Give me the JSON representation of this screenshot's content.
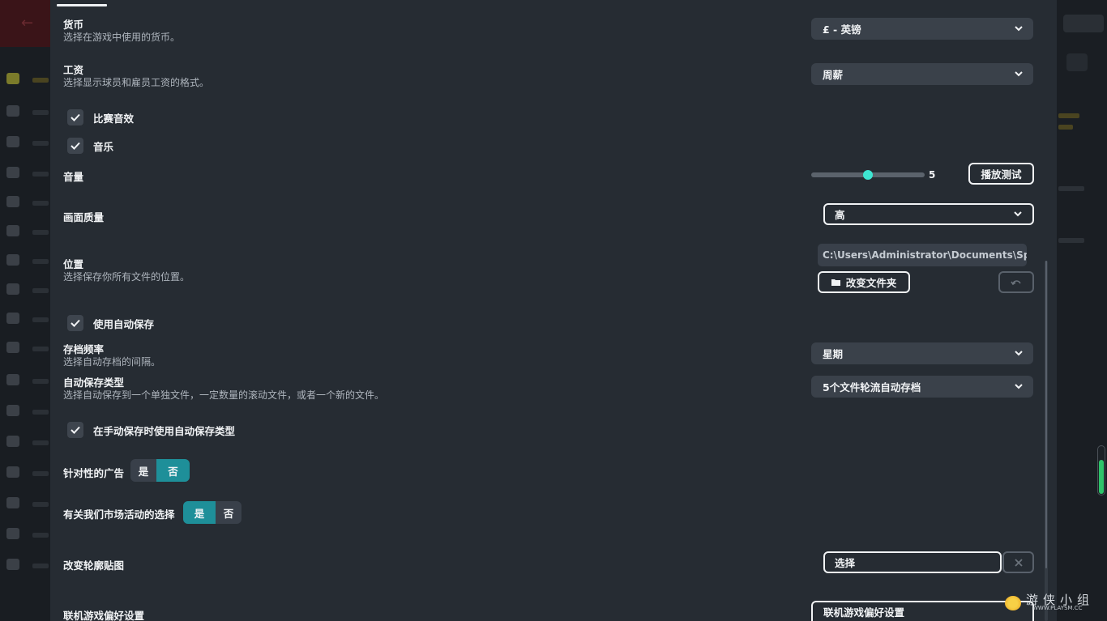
{
  "settings": {
    "currency": {
      "title": "货币",
      "description": "选择在游戏中使用的货币。",
      "value": "£ - 英镑"
    },
    "wages": {
      "title": "工资",
      "description": "选择显示球员和雇员工资的格式。",
      "value": "周薪"
    },
    "match_sound_effects": {
      "label": "比赛音效",
      "checked": true
    },
    "music": {
      "label": "音乐",
      "checked": true
    },
    "volume": {
      "label": "音量",
      "value": "5",
      "level_fraction": 0.5,
      "test_button": "播放测试"
    },
    "graphics_quality": {
      "label": "画面质量",
      "value": "高"
    },
    "location": {
      "title": "位置",
      "description": "选择保存你所有文件的位置。",
      "path": "C:\\Users\\Administrator\\Documents\\Spo...",
      "change_folder_button": "改变文件夹"
    },
    "use_autosave": {
      "label": "使用自动保存",
      "checked": true
    },
    "save_frequency": {
      "title": "存档频率",
      "description": "选择自动存档的间隔。",
      "value": "星期"
    },
    "autosave_type": {
      "title": "自动保存类型",
      "description": "选择自动保存到一个单独文件，一定数量的滚动文件，或者一个新的文件。",
      "value": "5个文件轮流自动存档"
    },
    "manual_save_autosave_type": {
      "label": "在手动保存时使用自动保存类型",
      "checked": true
    },
    "targeted_ads": {
      "label": "针对性的广告",
      "yes": "是",
      "no": "否",
      "selected": "否"
    },
    "marketing_choice": {
      "label": "有关我们市场活动的选择",
      "yes": "是",
      "no": "否",
      "selected": "是"
    },
    "change_kit_texture": {
      "label": "改变轮廓贴图",
      "button": "选择"
    },
    "online_preferences": {
      "label": "联机游戏偏好设置",
      "button": "联机游戏偏好设置"
    }
  },
  "watermark": {
    "brand": "游侠小组",
    "url": "WWW.PLAYSM.CC"
  },
  "colors": {
    "panel": "#262c33",
    "toggle_on": "#1e8f99",
    "slider_knob": "#3ee6d2",
    "gauge_fill": "#2ec46a"
  }
}
